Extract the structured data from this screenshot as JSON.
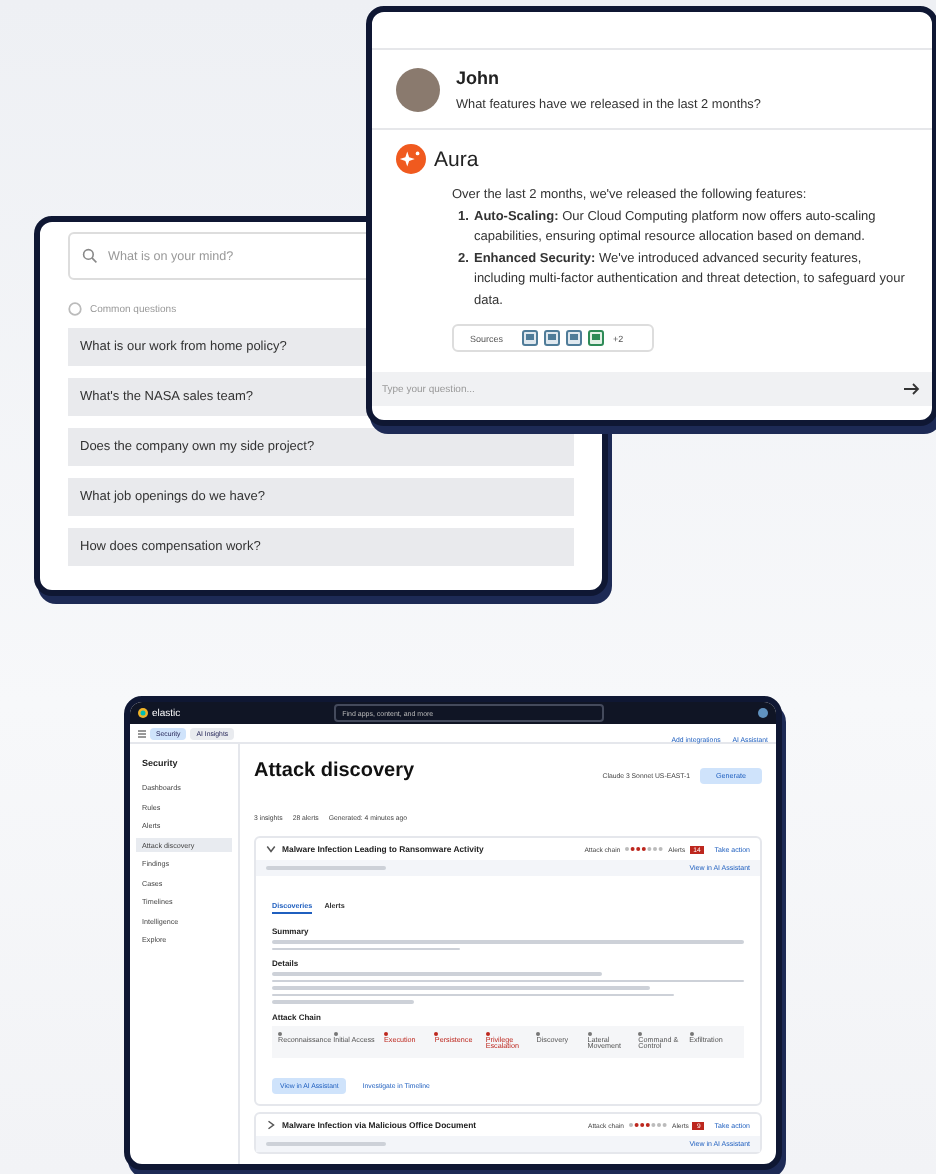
{
  "chat_window": {
    "user": {
      "name": "John",
      "message": "What features have we released in the last 2 months?"
    },
    "assistant": {
      "name": "Aura",
      "intro": "Over the last 2 months, we've released the following features:",
      "features": [
        {
          "number": "1.",
          "title": "Auto-Scaling:",
          "text": "Our Cloud Computing platform now offers auto-scaling capabilities, ensuring optimal resource allocation based on demand."
        },
        {
          "number": "2.",
          "title": "Enhanced Security:",
          "text": "We've introduced advanced security features, including multi-factor authentication and threat detection, to safeguard your data."
        }
      ],
      "sources": {
        "label": "Sources",
        "more": "+2"
      }
    },
    "input": {
      "placeholder": "Type your question..."
    }
  },
  "search_window": {
    "search": {
      "placeholder": "What is on your mind?"
    },
    "section": "Common questions",
    "questions": [
      "What is our work from home policy?",
      "What's the NASA sales team?",
      "Does the company own my side project?",
      "What job openings do we have?",
      "How does compensation work?"
    ]
  },
  "security_app": {
    "brand": "elastic",
    "search": {
      "placeholder": "Find apps, content, and more"
    },
    "breadcrumbs": [
      "Security",
      "AI Insights"
    ],
    "header_links": [
      "Add integrations",
      "AI Assistant"
    ],
    "sidebar": {
      "title": "Security",
      "items": [
        {
          "label": "Dashboards",
          "selected": false
        },
        {
          "label": "Rules",
          "selected": false
        },
        {
          "label": "Alerts",
          "selected": false
        },
        {
          "label": "Attack discovery",
          "selected": true
        },
        {
          "label": "Findings",
          "selected": false
        },
        {
          "label": "Cases",
          "selected": false
        },
        {
          "label": "Timelines",
          "selected": false
        },
        {
          "label": "Intelligence",
          "selected": false
        },
        {
          "label": "Explore",
          "selected": false
        }
      ]
    },
    "page_title": "Attack discovery",
    "model": "Claude 3 Sonnet US-EAST-1",
    "generate_button": "Generate",
    "stats": [
      "3 insights",
      "28 alerts",
      "Generated: 4 minutes ago"
    ],
    "discoveries": [
      {
        "title": "Malware Infection Leading to Ransomware Activity",
        "expanded": true,
        "attack_chain_label": "Attack chain",
        "alerts_label": "Alerts",
        "alerts_count": "14",
        "action": "Take action",
        "assistant_link": "View in AI Assistant"
      },
      {
        "title": "Malware Infection via Malicious Office Document",
        "expanded": false,
        "attack_chain_label": "Attack chain",
        "alerts_label": "Alerts",
        "alerts_count": "9",
        "action": "Take action",
        "assistant_link": "View in AI Assistant"
      }
    ],
    "tabs": [
      {
        "label": "Discoveries",
        "selected": true
      },
      {
        "label": "Alerts",
        "selected": false
      }
    ],
    "sections": [
      "Summary",
      "Details",
      "Attack Chain"
    ],
    "chain": [
      {
        "label": "Reconnaissance",
        "active": false
      },
      {
        "label": "Initial Access",
        "active": false
      },
      {
        "label": "Execution",
        "active": true
      },
      {
        "label": "Persistence",
        "active": true
      },
      {
        "label": "Privilege Escalation",
        "active": true
      },
      {
        "label": "Discovery",
        "active": false
      },
      {
        "label": "Lateral Movement",
        "active": false
      },
      {
        "label": "Command & Control",
        "active": false
      },
      {
        "label": "Exfiltration",
        "active": false
      }
    ],
    "buttons": [
      "View in AI Assistant",
      "Investigate in Timeline"
    ]
  }
}
